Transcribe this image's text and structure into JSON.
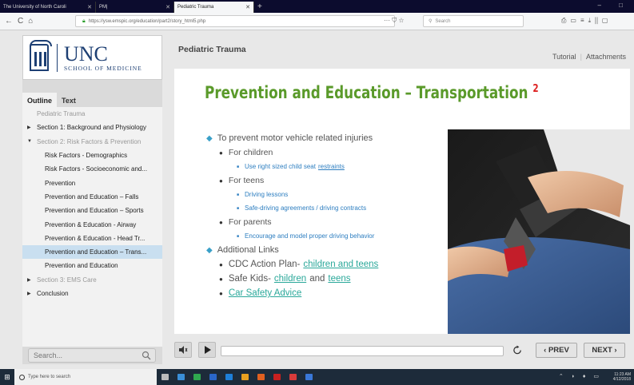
{
  "browser": {
    "tabs": [
      {
        "label": "The University of North Caroli",
        "active": false
      },
      {
        "label": "PM|",
        "active": false
      },
      {
        "label": "Pediatric Trauma",
        "active": true
      }
    ],
    "new_tab": "+",
    "url": "https://ysw.emspic.org/education/part2/story_html5.php",
    "url_domain": "emspic.org",
    "search_placeholder": "Search",
    "nav": {
      "back": "←",
      "forward": "→",
      "reload": "C",
      "home": "⌂"
    }
  },
  "logo": {
    "unc": "UNC",
    "school": "SCHOOL OF MEDICINE"
  },
  "sidebar": {
    "tabs": [
      {
        "label": "Outline",
        "active": true
      },
      {
        "label": "Text",
        "active": false
      }
    ],
    "items": [
      {
        "label": "Pediatric Trauma",
        "level": 0,
        "grey": true,
        "arrow": ""
      },
      {
        "label": "Section 1: Background and Physiology",
        "level": 0,
        "grey": false,
        "arrow": "▶"
      },
      {
        "label": "Section 2: Risk Factors & Prevention",
        "level": 0,
        "grey": true,
        "arrow": "▼"
      },
      {
        "label": "Risk Factors - Demographics",
        "level": 1,
        "grey": false,
        "arrow": ""
      },
      {
        "label": "Risk Factors - Socioeconomic and...",
        "level": 1,
        "grey": false,
        "arrow": ""
      },
      {
        "label": "Prevention",
        "level": 1,
        "grey": false,
        "arrow": ""
      },
      {
        "label": "Prevention and Education – Falls",
        "level": 1,
        "grey": false,
        "arrow": ""
      },
      {
        "label": "Prevention and Education – Sports",
        "level": 1,
        "grey": false,
        "arrow": ""
      },
      {
        "label": "Prevention & Education - Airway",
        "level": 1,
        "grey": false,
        "arrow": ""
      },
      {
        "label": "Prevention & Education - Head Tr...",
        "level": 1,
        "grey": false,
        "arrow": ""
      },
      {
        "label": "Prevention and Education – Trans...",
        "level": 1,
        "grey": false,
        "arrow": "",
        "selected": true
      },
      {
        "label": "Prevention and Education",
        "level": 1,
        "grey": false,
        "arrow": ""
      },
      {
        "label": "Section 3: EMS Care",
        "level": 0,
        "grey": true,
        "arrow": "▶"
      },
      {
        "label": "Conclusion",
        "level": 0,
        "grey": false,
        "arrow": "▶"
      }
    ],
    "search_placeholder": "Search..."
  },
  "header": {
    "title": "Pediatric Trauma",
    "links": [
      "Tutorial",
      "Attachments"
    ]
  },
  "slide": {
    "title": "Prevention and Education – Transportation",
    "superscript": "2",
    "content": [
      {
        "type": "b0",
        "text": "To prevent motor vehicle related injuries"
      },
      {
        "type": "b1",
        "text": "For children"
      },
      {
        "type": "b2",
        "text": "Use right sized child seat",
        "link": "restraints"
      },
      {
        "type": "b1",
        "text": "For teens"
      },
      {
        "type": "b2",
        "text": "Driving lessons"
      },
      {
        "type": "b2",
        "text": "Safe-driving agreements / driving contracts"
      },
      {
        "type": "b1",
        "text": "For parents"
      },
      {
        "type": "b2",
        "text": "Encourage and model proper driving behavior"
      },
      {
        "type": "b0",
        "text": "Additional Links"
      },
      {
        "type": "b1l",
        "text": "CDC Action Plan-",
        "link": "children and teens"
      },
      {
        "type": "b1l2",
        "text": "Safe Kids-",
        "link": "children",
        "mid": "and",
        "link2": "teens"
      },
      {
        "type": "b1l3",
        "link": "Car Safety Advice"
      }
    ]
  },
  "player": {
    "prev": "‹ PREV",
    "next": "NEXT ›"
  },
  "taskbar": {
    "search_placeholder": "Type here to search",
    "time": "11:23 AM",
    "date": "4/12/2018"
  },
  "colors": {
    "title_green": "#5a9a2a",
    "accent_blue": "#3aa0c8",
    "link_blue": "#2d7ec0",
    "selected_bg": "#c9dff0"
  }
}
